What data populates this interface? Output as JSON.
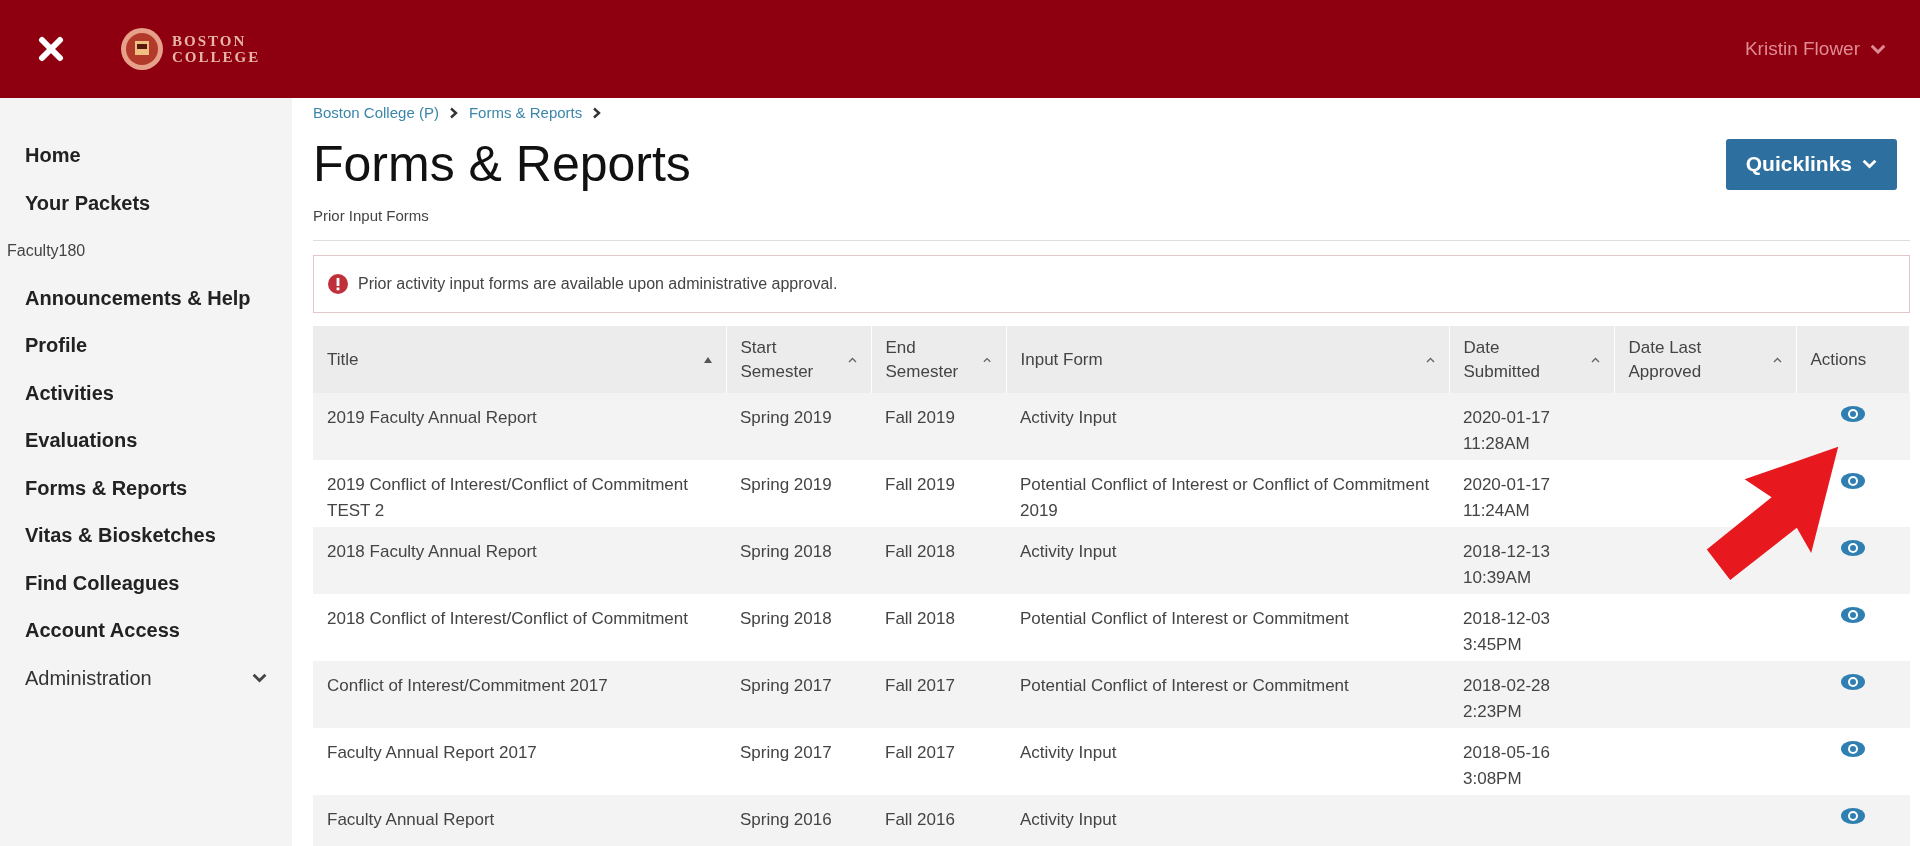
{
  "header": {
    "logo_lines": [
      "BOSTON",
      "COLLEGE"
    ],
    "user": "Kristin Flower"
  },
  "sidebar": {
    "items": [
      {
        "kind": "link",
        "label": "Home"
      },
      {
        "kind": "link",
        "label": "Your Packets"
      },
      {
        "kind": "section",
        "label": "Faculty180"
      },
      {
        "kind": "link",
        "label": "Announcements & Help"
      },
      {
        "kind": "link",
        "label": "Profile"
      },
      {
        "kind": "link",
        "label": "Activities"
      },
      {
        "kind": "link",
        "label": "Evaluations"
      },
      {
        "kind": "link",
        "label": "Forms & Reports"
      },
      {
        "kind": "link",
        "label": "Vitas & Biosketches"
      },
      {
        "kind": "link",
        "label": "Find Colleagues"
      },
      {
        "kind": "link",
        "label": "Account Access"
      },
      {
        "kind": "group",
        "label": "Administration",
        "expanded": false
      }
    ]
  },
  "breadcrumb": [
    "Boston College (P)",
    "Forms & Reports"
  ],
  "page_title": "Forms & Reports",
  "quicklinks": "Quicklinks",
  "subtitle": "Prior Input Forms",
  "alert": "Prior activity input forms are available upon administrative approval.",
  "table": {
    "columns": [
      {
        "label": "Title",
        "sortable": true,
        "sorted": true
      },
      {
        "label": "Start Semester",
        "sortable": true,
        "sorted": false
      },
      {
        "label": "End Semester",
        "sortable": true,
        "sorted": false
      },
      {
        "label": "Input Form",
        "sortable": true,
        "sorted": false
      },
      {
        "label": "Date Submitted",
        "sortable": true,
        "sorted": false
      },
      {
        "label": "Date Last Approved",
        "sortable": true,
        "sorted": false
      },
      {
        "label": "Actions",
        "sortable": false
      }
    ],
    "rows": [
      {
        "title": "2019 Faculty Annual Report",
        "start": "Spring 2019",
        "end": "Fall 2019",
        "form": "Activity Input",
        "submitted": [
          "2020-01-17",
          "11:28AM"
        ]
      },
      {
        "title": "2019 Conflict of Interest/Conflict of Commitment TEST 2",
        "start": "Spring 2019",
        "end": "Fall 2019",
        "form": "Potential Conflict of Interest or Conflict of Commitment 2019",
        "submitted": [
          "2020-01-17",
          "11:24AM"
        ]
      },
      {
        "title": "2018 Faculty Annual Report",
        "start": "Spring 2018",
        "end": "Fall 2018",
        "form": "Activity Input",
        "submitted": [
          "2018-12-13",
          "10:39AM"
        ]
      },
      {
        "title": "2018 Conflict of Interest/Conflict of Commitment",
        "start": "Spring 2018",
        "end": "Fall 2018",
        "form": "Potential Conflict of Interest or Commitment",
        "submitted": [
          "2018-12-03",
          "3:45PM"
        ]
      },
      {
        "title": "Conflict of Interest/Commitment 2017",
        "start": "Spring 2017",
        "end": "Fall 2017",
        "form": "Potential Conflict of Interest or Commitment",
        "submitted": [
          "2018-02-28",
          "2:23PM"
        ]
      },
      {
        "title": "Faculty Annual Report 2017",
        "start": "Spring 2017",
        "end": "Fall 2017",
        "form": "Activity Input",
        "submitted": [
          "2018-05-16",
          "3:08PM"
        ]
      },
      {
        "title": "Faculty Annual Report",
        "start": "Spring 2016",
        "end": "Fall 2016",
        "form": "Activity Input",
        "submitted": []
      }
    ]
  },
  "annotation": {
    "kind": "arrow"
  }
}
